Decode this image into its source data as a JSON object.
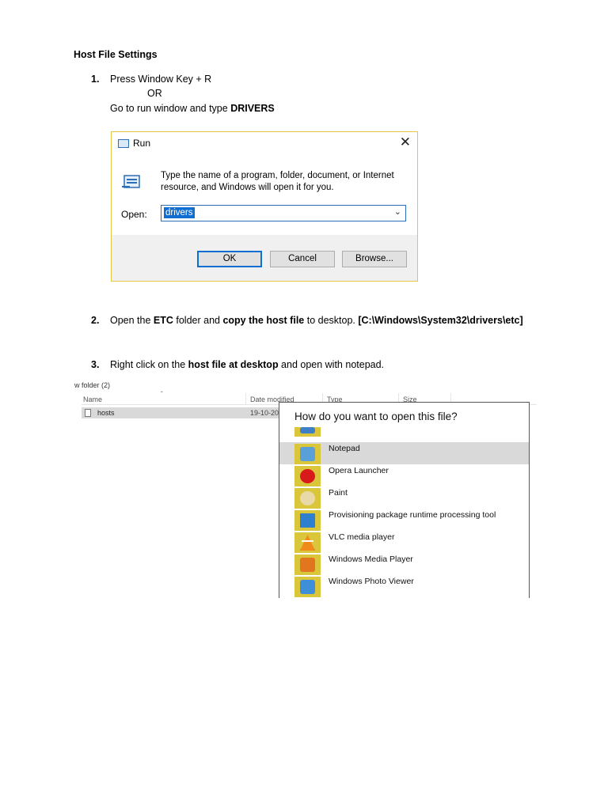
{
  "document": {
    "heading": "Host File Settings",
    "step1": {
      "num": "1.",
      "line1": "Press Window Key + R",
      "or": "OR",
      "line3_prefix": "Go to run window and type ",
      "line3_bold": "DRIVERS"
    },
    "step2": {
      "num": "2.",
      "t1": "Open the ",
      "b1": "ETC",
      "t2": " folder and ",
      "b2": "copy the host file",
      "t3": " to desktop. ",
      "b3": "[C:\\Windows\\System32\\drivers\\etc]"
    },
    "step3": {
      "num": "3.",
      "t1": "Right click on the ",
      "b1": "host file at desktop",
      "t2": " and open with notepad."
    }
  },
  "run_dialog": {
    "title": "Run",
    "close": "✕",
    "description": "Type the name of a program, folder, document, or Internet resource, and Windows will open it for you.",
    "open_label": "Open:",
    "open_value": "drivers",
    "ok": "OK",
    "cancel": "Cancel",
    "browse": "Browse..."
  },
  "explorer": {
    "folder": "w folder (2)",
    "col_name": "Name",
    "col_date": "Date modified",
    "col_type": "Type",
    "col_size": "Size",
    "file_name": "hosts",
    "file_date": "19-10-20"
  },
  "open_with": {
    "title": "How do you want to open this file?",
    "apps": [
      {
        "label": "Notepad",
        "icon": "notepad-icon",
        "color": "#5aa0d8"
      },
      {
        "label": "Opera Launcher",
        "icon": "opera-icon",
        "color": "#d81a1a"
      },
      {
        "label": "Paint",
        "icon": "paint-icon",
        "color": "#e9d9a8"
      },
      {
        "label": "Provisioning package runtime processing tool",
        "icon": "provisioning-icon",
        "color": "#2f7fd0"
      },
      {
        "label": "VLC media player",
        "icon": "vlc-icon",
        "color": "#f08a1c"
      },
      {
        "label": "Windows Media Player",
        "icon": "media-player-icon",
        "color": "#e2761e"
      },
      {
        "label": "Windows Photo Viewer",
        "icon": "photo-viewer-icon",
        "color": "#3f8fd8"
      }
    ]
  }
}
